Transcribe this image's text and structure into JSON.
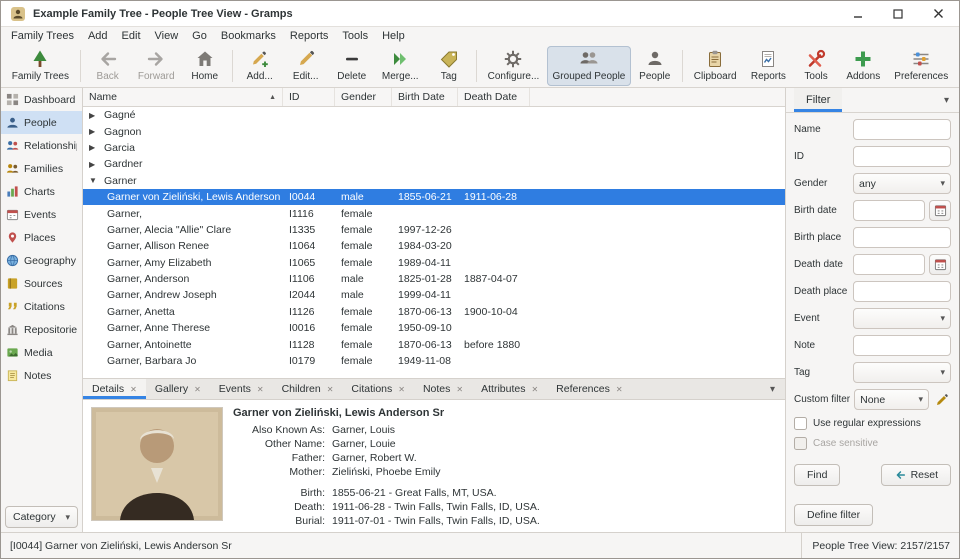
{
  "colors": {
    "accent": "#3584e4",
    "selection": "#2f7de1",
    "sidebar_active": "#cfe0f4"
  },
  "window": {
    "title": "Example Family Tree - People Tree View - Gramps"
  },
  "menubar": {
    "items": [
      "Family Trees",
      "Add",
      "Edit",
      "View",
      "Go",
      "Bookmarks",
      "Reports",
      "Tools",
      "Help"
    ]
  },
  "toolbar": {
    "buttons": [
      {
        "label": "Family Trees",
        "icon": "family-trees-icon"
      },
      {
        "label": "Back",
        "icon": "back-icon",
        "disabled": true
      },
      {
        "label": "Forward",
        "icon": "forward-icon",
        "disabled": true
      },
      {
        "label": "Home",
        "icon": "home-icon"
      },
      {
        "label": "Add...",
        "icon": "add-icon"
      },
      {
        "label": "Edit...",
        "icon": "edit-icon"
      },
      {
        "label": "Delete",
        "icon": "delete-icon"
      },
      {
        "label": "Merge...",
        "icon": "merge-icon"
      },
      {
        "label": "Tag",
        "icon": "tag-icon"
      },
      {
        "label": "Configure...",
        "icon": "configure-icon"
      },
      {
        "label": "Grouped People",
        "icon": "grouped-people-icon",
        "active": true
      },
      {
        "label": "People",
        "icon": "person-icon"
      },
      {
        "label": "Clipboard",
        "icon": "clipboard-icon"
      },
      {
        "label": "Reports",
        "icon": "reports-icon"
      },
      {
        "label": "Tools",
        "icon": "tools-icon"
      },
      {
        "label": "Addons",
        "icon": "addons-icon"
      },
      {
        "label": "Preferences",
        "icon": "preferences-icon"
      }
    ]
  },
  "sidebar": {
    "items": [
      {
        "label": "Dashboard"
      },
      {
        "label": "People",
        "active": true
      },
      {
        "label": "Relationships"
      },
      {
        "label": "Families"
      },
      {
        "label": "Charts"
      },
      {
        "label": "Events"
      },
      {
        "label": "Places"
      },
      {
        "label": "Geography"
      },
      {
        "label": "Sources"
      },
      {
        "label": "Citations"
      },
      {
        "label": "Repositories"
      },
      {
        "label": "Media"
      },
      {
        "label": "Notes"
      }
    ],
    "category_label": "Category"
  },
  "icons": {
    "sort_ascending": "▲",
    "expander_collapsed": "▶",
    "expander_expanded": "▼",
    "tab_close": "✕",
    "dropdown_caret": "▾"
  },
  "people_table": {
    "columns": [
      "Name",
      "ID",
      "Gender",
      "Birth Date",
      "Death Date"
    ],
    "sorted_by": "Name",
    "rows": [
      {
        "type": "group",
        "name": "Gagné",
        "expanded": false
      },
      {
        "type": "group",
        "name": "Gagnon",
        "expanded": false
      },
      {
        "type": "group",
        "name": "Garcia",
        "expanded": false
      },
      {
        "type": "group",
        "name": "Gardner",
        "expanded": false
      },
      {
        "type": "group",
        "name": "Garner",
        "expanded": true
      },
      {
        "type": "person",
        "name": "Garner von Zieliński, Lewis Anderson Sr",
        "id": "I0044",
        "gender": "male",
        "birth": "1855-06-21",
        "death": "1911-06-28",
        "selected": true
      },
      {
        "type": "person",
        "name": "Garner,",
        "id": "I1116",
        "gender": "female",
        "birth": "",
        "death": ""
      },
      {
        "type": "person",
        "name": "Garner, Alecia \"Allie\" Clare",
        "id": "I1335",
        "gender": "female",
        "birth": "1997-12-26",
        "death": ""
      },
      {
        "type": "person",
        "name": "Garner, Allison Renee",
        "id": "I1064",
        "gender": "female",
        "birth": "1984-03-20",
        "death": ""
      },
      {
        "type": "person",
        "name": "Garner, Amy Elizabeth",
        "id": "I1065",
        "gender": "female",
        "birth": "1989-04-11",
        "death": ""
      },
      {
        "type": "person",
        "name": "Garner, Anderson",
        "id": "I1106",
        "gender": "male",
        "birth": "1825-01-28",
        "death": "1887-04-07"
      },
      {
        "type": "person",
        "name": "Garner, Andrew Joseph",
        "id": "I2044",
        "gender": "male",
        "birth": "1999-04-11",
        "death": ""
      },
      {
        "type": "person",
        "name": "Garner, Anetta",
        "id": "I1126",
        "gender": "female",
        "birth": "1870-06-13",
        "death": "1900-10-04"
      },
      {
        "type": "person",
        "name": "Garner, Anne Therese",
        "id": "I0016",
        "gender": "female",
        "birth": "1950-09-10",
        "death": ""
      },
      {
        "type": "person",
        "name": "Garner, Antoinette",
        "id": "I1128",
        "gender": "female",
        "birth": "1870-06-13",
        "death": "before 1880"
      },
      {
        "type": "person",
        "name": "Garner, Barbara Jo",
        "id": "I0179",
        "gender": "female",
        "birth": "1949-11-08",
        "death": ""
      }
    ]
  },
  "detail_tabs": [
    {
      "label": "Details",
      "active": true
    },
    {
      "label": "Gallery"
    },
    {
      "label": "Events"
    },
    {
      "label": "Children"
    },
    {
      "label": "Citations"
    },
    {
      "label": "Notes"
    },
    {
      "label": "Attributes"
    },
    {
      "label": "References"
    }
  ],
  "details": {
    "title": "Garner von Zieliński, Lewis Anderson Sr",
    "fields": [
      {
        "label": "Also Known As:",
        "value": "Garner, Louis"
      },
      {
        "label": "Other Name:",
        "value": "Garner, Louie"
      },
      {
        "label": "Father:",
        "value": "Garner, Robert W."
      },
      {
        "label": "Mother:",
        "value": "Zieliński, Phoebe Emily"
      }
    ],
    "vitals": [
      {
        "label": "Birth:",
        "value": "1855-06-21 - Great Falls, MT, USA."
      },
      {
        "label": "Death:",
        "value": "1911-06-28 - Twin Falls, Twin Falls, ID, USA."
      },
      {
        "label": "Burial:",
        "value": "1911-07-01 - Twin Falls, Twin Falls, ID, USA."
      }
    ]
  },
  "filter": {
    "title": "Filter",
    "fields": [
      {
        "label": "Name",
        "value": ""
      },
      {
        "label": "ID",
        "value": ""
      },
      {
        "label": "Gender",
        "value": "any"
      },
      {
        "label": "Birth date",
        "value": ""
      },
      {
        "label": "Birth place",
        "value": ""
      },
      {
        "label": "Death date",
        "value": ""
      },
      {
        "label": "Death place",
        "value": ""
      },
      {
        "label": "Event",
        "value": ""
      },
      {
        "label": "Note",
        "value": ""
      },
      {
        "label": "Tag",
        "value": ""
      },
      {
        "label": "Custom filter",
        "value": "None"
      }
    ],
    "checkboxes": [
      {
        "label": "Use regular expressions",
        "checked": false
      },
      {
        "label": "Case sensitive",
        "checked": false,
        "disabled": true
      }
    ],
    "find_label": "Find",
    "reset_label": "Reset",
    "define_label": "Define filter"
  },
  "statusbar": {
    "left": "[I0044] Garner von Zieliński, Lewis Anderson Sr",
    "right": "People Tree View: 2157/2157"
  }
}
